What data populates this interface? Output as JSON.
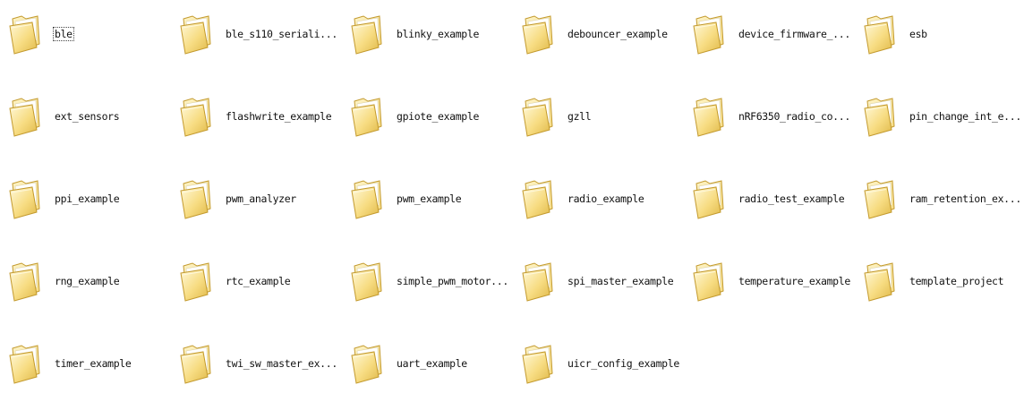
{
  "colors": {
    "folder_light": "#fdf3c6",
    "folder_mid": "#f7dc82",
    "folder_dark": "#e0b94a",
    "folder_outline": "#c39a2e",
    "text": "#111111"
  },
  "icon": "folder-icon",
  "folders": [
    {
      "label": "ble",
      "selected": true
    },
    {
      "label": "ble_s110_seriali..."
    },
    {
      "label": "blinky_example"
    },
    {
      "label": "debouncer_example"
    },
    {
      "label": "device_firmware_..."
    },
    {
      "label": "esb"
    },
    {
      "label": "ext_sensors"
    },
    {
      "label": "flashwrite_example"
    },
    {
      "label": "gpiote_example"
    },
    {
      "label": "gzll"
    },
    {
      "label": "nRF6350_radio_co..."
    },
    {
      "label": "pin_change_int_e..."
    },
    {
      "label": "ppi_example"
    },
    {
      "label": "pwm_analyzer"
    },
    {
      "label": "pwm_example"
    },
    {
      "label": "radio_example"
    },
    {
      "label": "radio_test_example"
    },
    {
      "label": "ram_retention_ex..."
    },
    {
      "label": "rng_example"
    },
    {
      "label": "rtc_example"
    },
    {
      "label": "simple_pwm_motor..."
    },
    {
      "label": "spi_master_example"
    },
    {
      "label": "temperature_example"
    },
    {
      "label": "template_project"
    },
    {
      "label": "timer_example"
    },
    {
      "label": "twi_sw_master_ex..."
    },
    {
      "label": "uart_example"
    },
    {
      "label": "uicr_config_example"
    }
  ]
}
